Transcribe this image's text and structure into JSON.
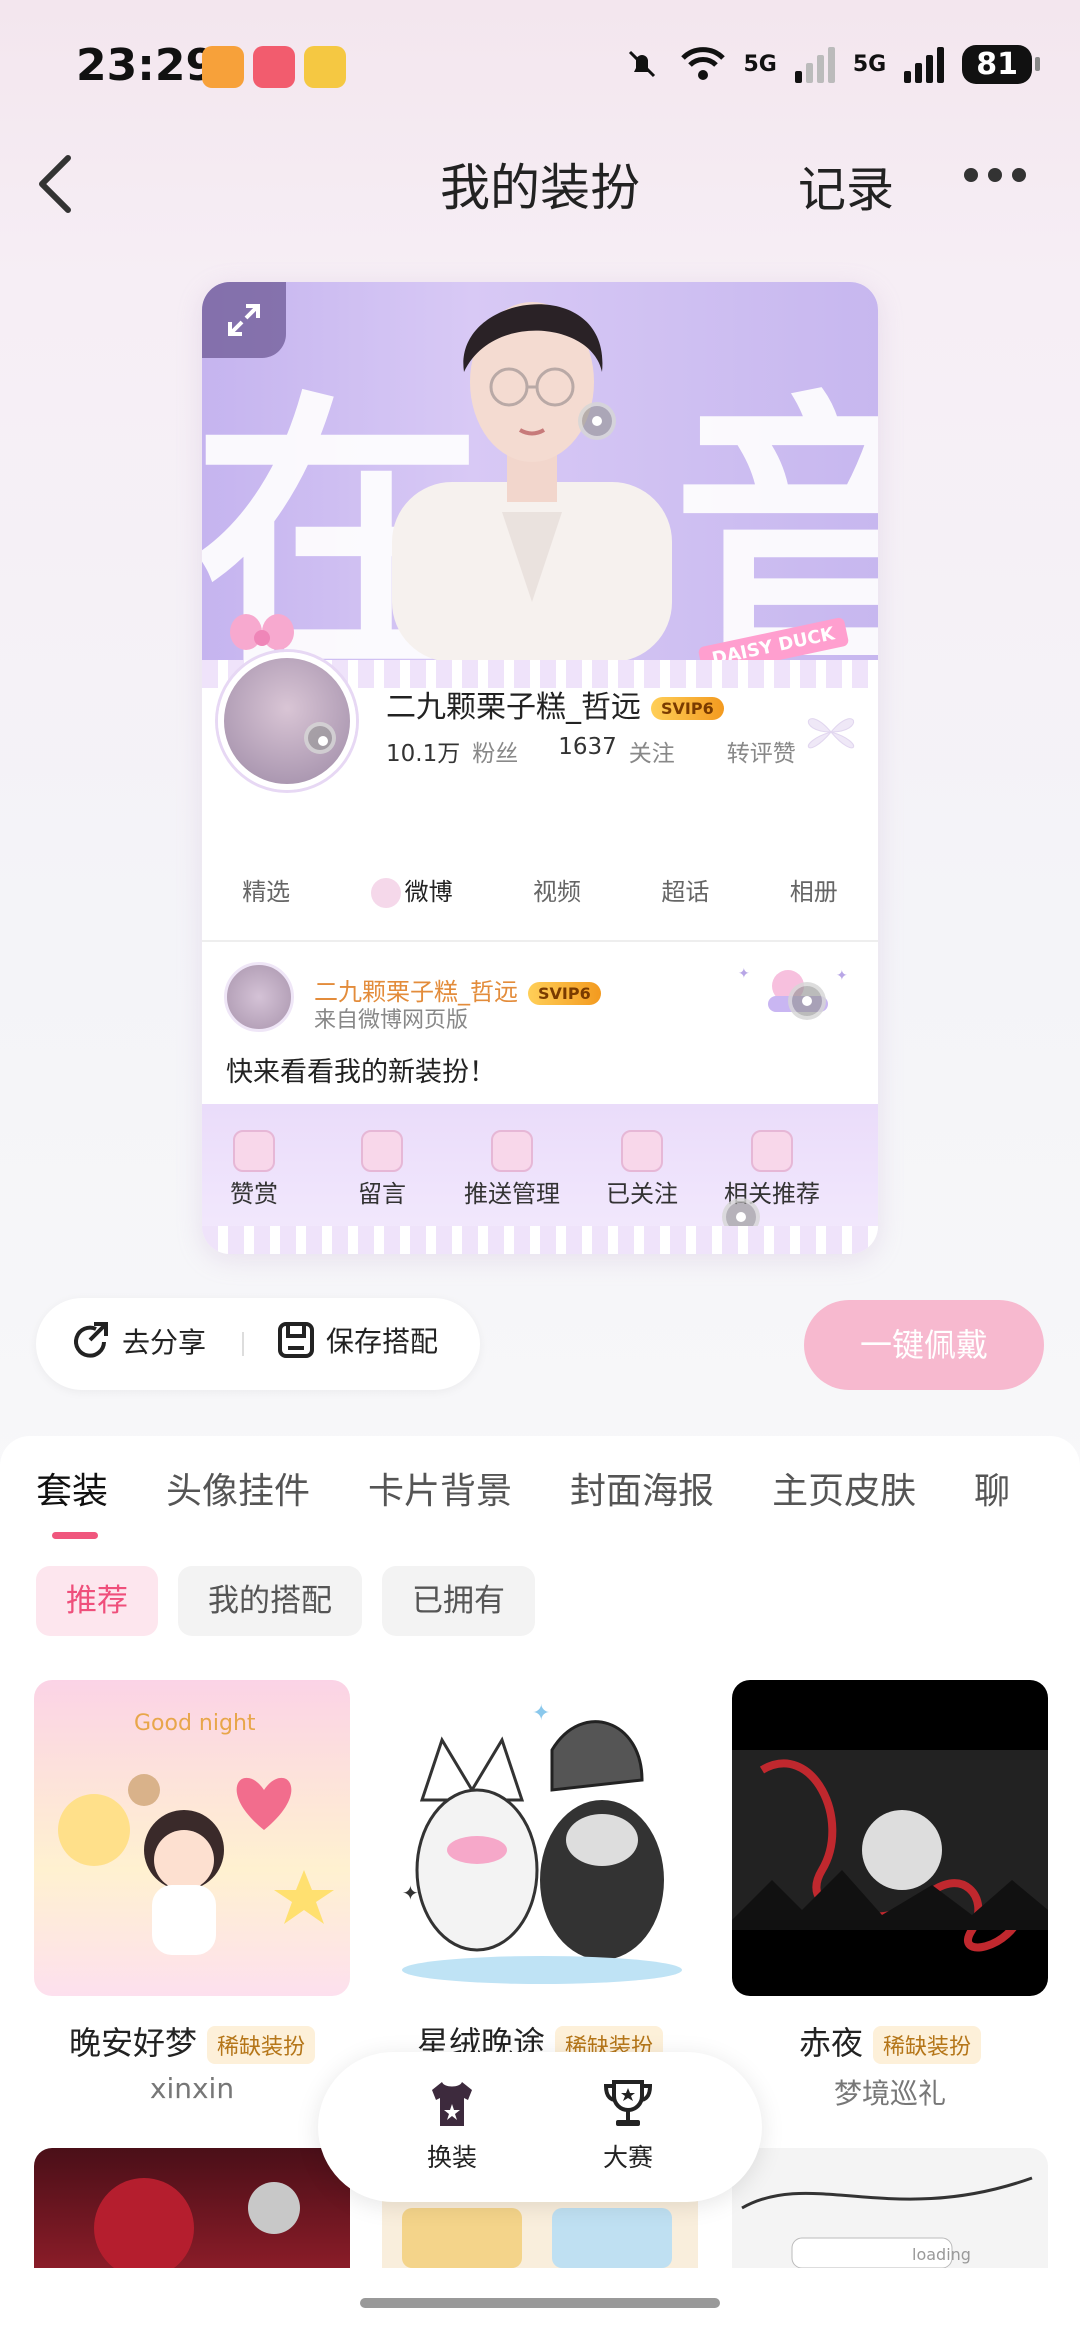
{
  "status_bar": {
    "time": "23:29",
    "network_1": "5G",
    "network_2": "5G",
    "battery": "81"
  },
  "header": {
    "title": "我的装扮",
    "records_label": "记录"
  },
  "preview": {
    "cover_chars": [
      "在",
      "音"
    ],
    "tag": "DAISY DUCK",
    "username": "二九颗栗子糕_哲远",
    "vip_badge": "SVIP6",
    "fans_count": "10.1万",
    "fans_label": "粉丝",
    "follow_count": "1637",
    "follow_label": "关注",
    "likes_label": "转评赞",
    "tabs": [
      "精选",
      "微博",
      "视频",
      "超话",
      "相册"
    ],
    "post": {
      "name": "二九颗栗子糕_哲远",
      "badge": "SVIP6",
      "source": "来自微博网页版",
      "text": "快来看看我的新装扮！"
    },
    "actions": [
      "赞赏",
      "留言",
      "推送管理",
      "已关注",
      "相关推荐"
    ]
  },
  "share": {
    "share_label": "去分享",
    "save_label": "保存搭配",
    "wear_label": "一键佩戴"
  },
  "categories": [
    "套装",
    "头像挂件",
    "卡片背景",
    "封面海报",
    "主页皮肤",
    "聊"
  ],
  "chips": [
    "推荐",
    "我的搭配",
    "已拥有"
  ],
  "items": [
    {
      "name": "晚安好梦",
      "rare": "稀缺装扮",
      "author": "xinxin"
    },
    {
      "name": "星绒晚途",
      "rare": "稀缺装扮",
      "author": ""
    },
    {
      "name": "赤夜",
      "rare": "稀缺装扮",
      "author": "梦境巡礼"
    }
  ],
  "thumb_text": {
    "goodnight": "Good night",
    "loading": "loading"
  },
  "bottom_nav": [
    {
      "label": "换装"
    },
    {
      "label": "大赛"
    }
  ]
}
